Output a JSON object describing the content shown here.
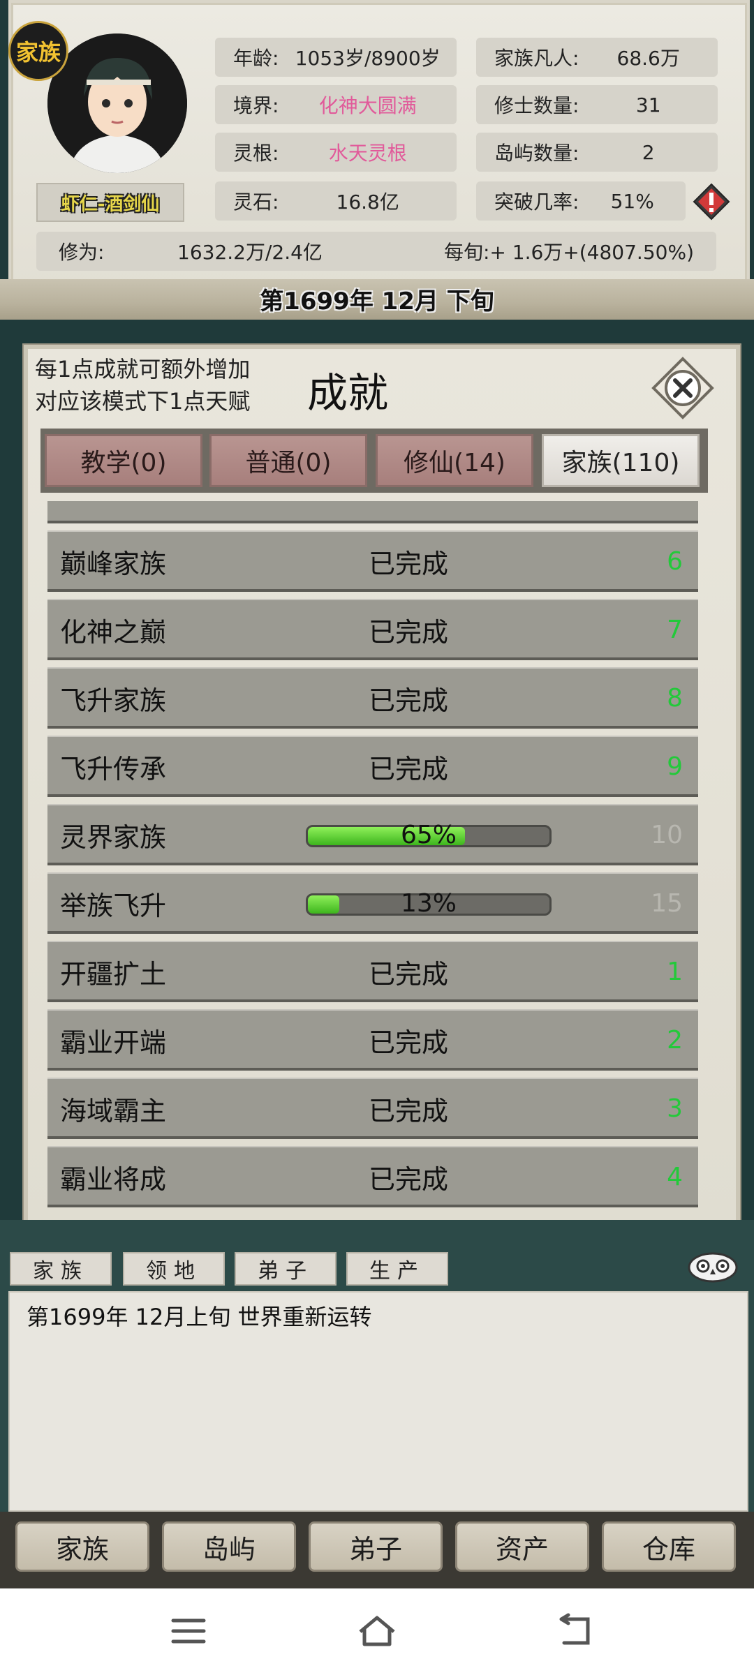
{
  "header": {
    "badge": "家族",
    "player_name": "虾仁-酒剑仙",
    "stats_left": [
      {
        "label": "年龄:",
        "value": "1053岁/8900岁",
        "color": "#222222"
      },
      {
        "label": "境界:",
        "value": "化神大圆满",
        "color": "#e15a9a"
      },
      {
        "label": "灵根:",
        "value": "水天灵根",
        "color": "#e15a9a"
      },
      {
        "label": "灵石:",
        "value": "16.8亿",
        "color": "#222222"
      }
    ],
    "stats_right": [
      {
        "label": "家族凡人:",
        "value": "68.6万"
      },
      {
        "label": "修士数量:",
        "value": "31"
      },
      {
        "label": "岛屿数量:",
        "value": "2"
      },
      {
        "label": "突破几率:",
        "value": "51%"
      }
    ],
    "cultivation_label": "修为:",
    "cultivation_value": "1632.2万/2.4亿",
    "per_turn": "每旬:+ 1.6万+(4807.50%)",
    "date": "第1699年 12月 下旬"
  },
  "dialog": {
    "hint_line1": "每1点成就可额外增加",
    "hint_line2": "对应该模式下1点天赋",
    "title": "成就",
    "tabs": [
      {
        "label": "教学(0)",
        "active": false
      },
      {
        "label": "普通(0)",
        "active": false
      },
      {
        "label": "修仙(14)",
        "active": false
      },
      {
        "label": "家族(110)",
        "active": true
      }
    ],
    "rows": [
      {
        "name": "巅峰家族",
        "status": "已完成",
        "reward": "6",
        "done": true
      },
      {
        "name": "化神之巅",
        "status": "已完成",
        "reward": "7",
        "done": true
      },
      {
        "name": "飞升家族",
        "status": "已完成",
        "reward": "8",
        "done": true
      },
      {
        "name": "飞升传承",
        "status": "已完成",
        "reward": "9",
        "done": true
      },
      {
        "name": "灵界家族",
        "progress": 0.65,
        "progress_text": "65%",
        "reward": "10",
        "done": false
      },
      {
        "name": "举族飞升",
        "progress": 0.13,
        "progress_text": "13%",
        "reward": "15",
        "done": false
      },
      {
        "name": "开疆扩土",
        "status": "已完成",
        "reward": "1",
        "done": true
      },
      {
        "name": "霸业开端",
        "status": "已完成",
        "reward": "2",
        "done": true
      },
      {
        "name": "海域霸主",
        "status": "已完成",
        "reward": "3",
        "done": true
      },
      {
        "name": "霸业将成",
        "status": "已完成",
        "reward": "4",
        "done": true
      }
    ]
  },
  "log": {
    "tabs": [
      "家族",
      "领地",
      "弟子",
      "生产"
    ],
    "line": "第1699年 12月上旬 世界重新运转"
  },
  "nav": [
    "家族",
    "岛屿",
    "弟子",
    "资产",
    "仓库"
  ],
  "colors": {
    "accent_green": "#23c93a",
    "pink": "#e15a9a"
  }
}
